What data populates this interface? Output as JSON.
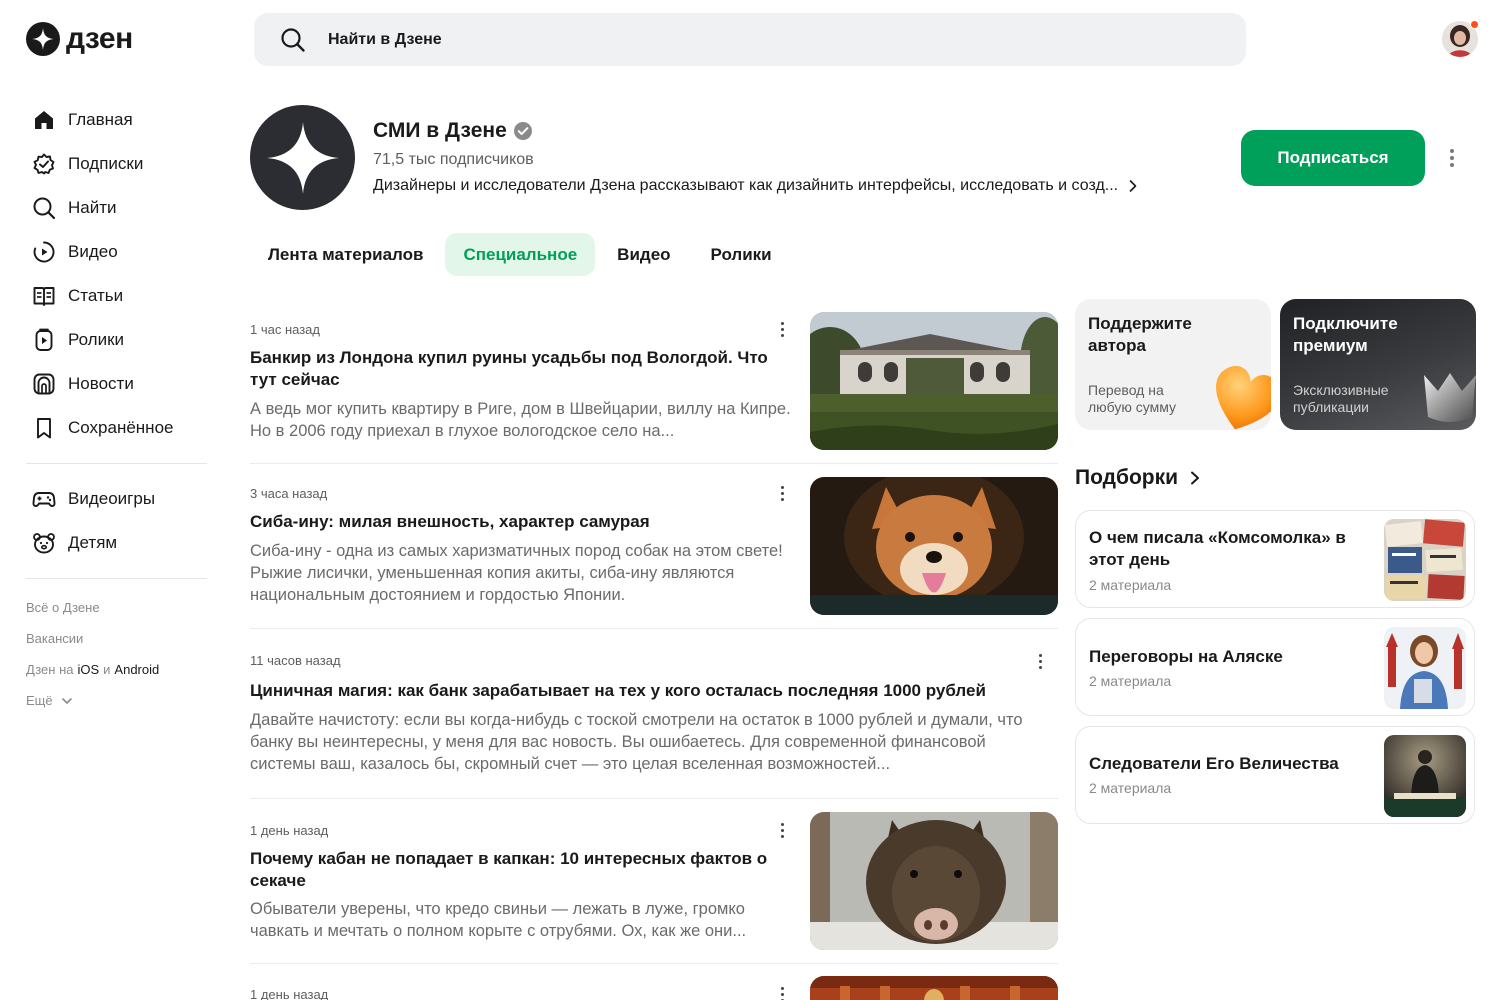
{
  "header": {
    "logo_text": "дзен",
    "search_placeholder": "Найти в Дзене"
  },
  "sidebar": {
    "items": [
      {
        "label": "Главная",
        "icon": "home-icon"
      },
      {
        "label": "Подписки",
        "icon": "subscriptions-icon"
      },
      {
        "label": "Найти",
        "icon": "search-icon"
      },
      {
        "label": "Видео",
        "icon": "video-icon"
      },
      {
        "label": "Статьи",
        "icon": "articles-icon"
      },
      {
        "label": "Ролики",
        "icon": "shorts-icon"
      },
      {
        "label": "Новости",
        "icon": "news-icon"
      },
      {
        "label": "Сохранённое",
        "icon": "bookmark-icon"
      }
    ],
    "extra_items": [
      {
        "label": "Видеоигры",
        "icon": "gamepad-icon"
      },
      {
        "label": "Детям",
        "icon": "kids-icon"
      }
    ],
    "footer": {
      "about": "Всё о Дзене",
      "jobs": "Вакансии",
      "apps_prefix": "Дзен на",
      "apps_ios": "iOS",
      "apps_and": "и",
      "apps_android": "Android",
      "more": "Ещё"
    }
  },
  "channel": {
    "title": "СМИ в Дзене",
    "subscribers": "71,5 тыс подписчиков",
    "description": "Дизайнеры и исследователи Дзена рассказывают как дизайнить интерфейсы, исследовать и созд...",
    "subscribe_label": "Подписаться"
  },
  "tabs": [
    {
      "label": "Лента материалов",
      "active": false
    },
    {
      "label": "Специальное",
      "active": true
    },
    {
      "label": "Видео",
      "active": false
    },
    {
      "label": "Ролики",
      "active": false
    }
  ],
  "feed": [
    {
      "time": "1 час назад",
      "title": "Банкир из Лондона купил руины усадьбы под Вологдой. Что тут сейчас",
      "text": "А ведь мог купить квартиру в Риге, дом в Швейцарии, виллу на Кипре. Но в 2006 году приехал в глухое вологодское село на..."
    },
    {
      "time": "3 часа назад",
      "title": "Сиба-ину: милая внешность, характер самурая",
      "text": "Сиба-ину - одна из самых харизматичных пород собак на этом свете! Рыжие лисички, уменьшенная копия акиты, сиба-ину являются национальным достоянием и гордостью Японии."
    },
    {
      "time": "11 часов назад",
      "title": "Циничная магия: как банк зарабатывает на тех у кого осталась последняя 1000 рублей",
      "text": "Давайте начистоту: если вы когда-нибудь с тоской смотрели на остаток в 1000 рублей и думали, что банку вы неинтересны, у меня для вас новость. Вы ошибаетесь. Для современной финансовой системы ваш, казалось бы, скромный счет — это целая вселенная возможностей..."
    },
    {
      "time": "1 день назад",
      "title": "Почему кабан не попадает в капкан: 10 интересных фактов о секаче",
      "text": "Обыватели уверены, что кредо свиньи — лежать в луже, громко чавкать и мечтать о полном корыте с отрубями. Ох, как же они..."
    },
    {
      "time": "1 день назад",
      "title": "",
      "text": ""
    }
  ],
  "promo": {
    "support_title": "Поддержите автора",
    "support_sub": "Перевод на любую сумму",
    "premium_title": "Подключите премиум",
    "premium_sub": "Эксклюзивные публикации"
  },
  "selections": {
    "heading": "Подборки",
    "items": [
      {
        "title": "О чем писала «Комсомолка» в этот день",
        "count": "2 материала"
      },
      {
        "title": "Переговоры на Аляске",
        "count": "2 материала"
      },
      {
        "title": "Следователи Его Величества",
        "count": "2 материала"
      }
    ]
  },
  "colors": {
    "accent_green": "#00a05a",
    "active_tab_bg": "#e3f6ea",
    "notification_dot": "#ff4d1f"
  }
}
